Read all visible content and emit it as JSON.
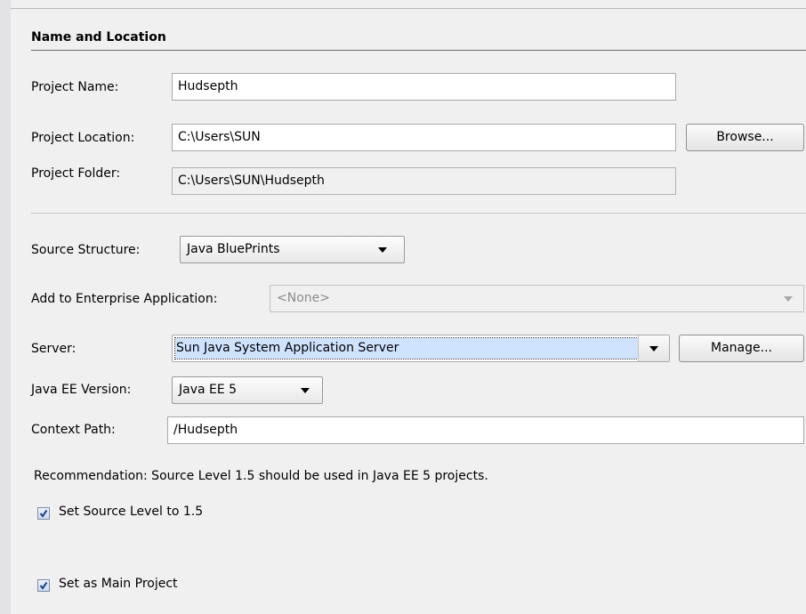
{
  "section": {
    "title": "Name and Location"
  },
  "project": {
    "name_label": "Project Name:",
    "name_value": "Hudsepth",
    "location_label": "Project Location:",
    "location_value": "C:\\Users\\SUN",
    "browse_label": "Browse...",
    "folder_label": "Project Folder:",
    "folder_value": "C:\\Users\\SUN\\Hudsepth"
  },
  "source_structure": {
    "label": "Source Structure:",
    "value": "Java BluePrints"
  },
  "enterprise": {
    "label": "Add to Enterprise Application:",
    "value": "<None>"
  },
  "server": {
    "label": "Server:",
    "value": "Sun Java System Application Server",
    "manage_label": "Manage..."
  },
  "java_ee": {
    "label": "Java EE Version:",
    "value": "Java EE 5"
  },
  "context_path": {
    "label": "Context Path:",
    "value": "/Hudsepth"
  },
  "recommendation": {
    "text": "Recommendation: Source Level 1.5 should be used in Java EE 5 projects."
  },
  "options": {
    "source_level_label": "Set Source Level to 1.5",
    "source_level_checked": true,
    "main_project_label": "Set as Main Project",
    "main_project_checked": true
  }
}
